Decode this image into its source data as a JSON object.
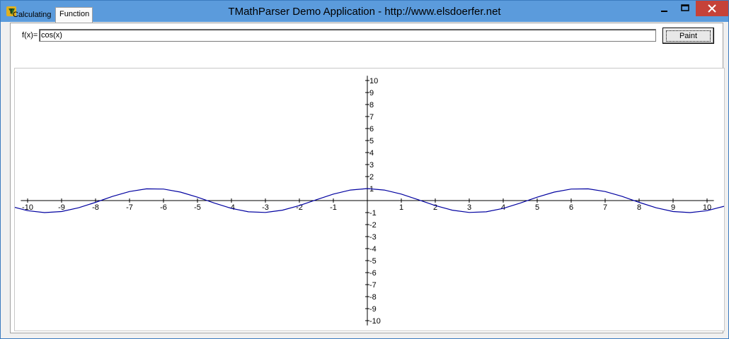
{
  "window": {
    "title": "TMathParser Demo Application - http://www.elsdoerfer.net",
    "minimize_glyph": "–",
    "maximize_glyph": "□",
    "close_glyph": "✕"
  },
  "tabs": [
    {
      "label": "Calculating",
      "active": false
    },
    {
      "label": "Function",
      "active": true
    }
  ],
  "function_panel": {
    "input_label": "f(x)=",
    "input_value": "cos(x)",
    "paint_label": "Paint"
  },
  "colors": {
    "curve": "#0000a0",
    "titlebar": "#5b9bdc",
    "close": "#c64238"
  },
  "chart_data": {
    "type": "line",
    "function": "cos(x)",
    "xlim": [
      -10.5,
      10.5
    ],
    "ylim": [
      -10.5,
      10.5
    ],
    "x_ticks": [
      -10,
      -9,
      -8,
      -7,
      -6,
      -5,
      -4,
      -3,
      -2,
      -1,
      1,
      2,
      3,
      4,
      5,
      6,
      7,
      8,
      9,
      10
    ],
    "y_ticks": [
      10,
      9,
      8,
      7,
      6,
      5,
      4,
      3,
      2,
      1,
      -1,
      -2,
      -3,
      -4,
      -5,
      -6,
      -7,
      -8,
      -9,
      -10
    ],
    "series": [
      {
        "x": [
          -10.5,
          -10,
          -9.5,
          -9,
          -8.5,
          -8,
          -7.5,
          -7,
          -6.5,
          -6,
          -5.5,
          -5,
          -4.5,
          -4,
          -3.5,
          -3,
          -2.5,
          -2,
          -1.5,
          -1,
          -0.5,
          0,
          0.5,
          1,
          1.5,
          2,
          2.5,
          3,
          3.5,
          4,
          4.5,
          5,
          5.5,
          6,
          6.5,
          7,
          7.5,
          8,
          8.5,
          9,
          9.5,
          10,
          10.5
        ],
        "y": [
          -0.4755,
          -0.8391,
          -0.9972,
          -0.9111,
          -0.602,
          -0.1455,
          0.3466,
          0.7539,
          0.9766,
          0.9602,
          0.7087,
          0.2837,
          -0.2108,
          -0.6536,
          -0.9365,
          -0.99,
          -0.8011,
          -0.4161,
          0.0707,
          0.5403,
          0.8776,
          1.0,
          0.8776,
          0.5403,
          0.0707,
          -0.4161,
          -0.8011,
          -0.99,
          -0.9365,
          -0.6536,
          -0.2108,
          0.2837,
          0.7087,
          0.9602,
          0.9766,
          0.7539,
          0.3466,
          -0.1455,
          -0.602,
          -0.9111,
          -0.9972,
          -0.8391,
          -0.4755
        ]
      }
    ]
  }
}
